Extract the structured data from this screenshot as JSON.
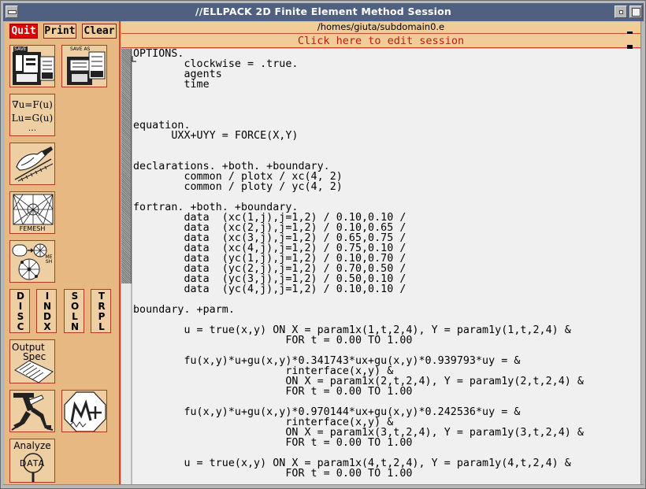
{
  "window": {
    "title": "//ELLPACK 2D Finite Element Method Session"
  },
  "toolbar": {
    "quit_label": "Quit",
    "print_label": "Print",
    "clear_label": "Clear"
  },
  "tools": {
    "save_label": "SAVE",
    "save_as_label": "SAVE AS",
    "pde_line1": "∇u=F(u)",
    "pde_line2": "Lu=G(u)",
    "pde_line3": "...",
    "femesh_label": "FEMESH",
    "mesh_label": "MESH",
    "discu": "DISCU",
    "indxu": "INDXU",
    "solnu": "SOLNU",
    "trplu": "TRPLU",
    "output_line1": "Output",
    "output_line2": "Spec",
    "analyze_line1": "Analyze",
    "analyze_line2": "DATA"
  },
  "session": {
    "path": "/homes/giuta/subdomain0.e",
    "edit_prompt": "Click here to edit session"
  },
  "code_lines": [
    "OPTIONS.",
    "        clockwise = .true.",
    "        agents",
    "        time",
    "",
    "",
    "",
    "equation.",
    "      UXX+UYY = FORCE(X,Y)",
    "",
    "",
    "declarations. +both. +boundary.",
    "        common / plotx / xc(4, 2)",
    "        common / ploty / yc(4, 2)",
    "",
    "fortran. +both. +boundary.",
    "        data  (xc(1,j),j=1,2) / 0.10,0.10 /",
    "        data  (xc(2,j),j=1,2) / 0.10,0.65 /",
    "        data  (xc(3,j),j=1,2) / 0.65,0.75 /",
    "        data  (xc(4,j),j=1,2) / 0.75,0.10 /",
    "        data  (yc(1,j),j=1,2) / 0.10,0.70 /",
    "        data  (yc(2,j),j=1,2) / 0.70,0.50 /",
    "        data  (yc(3,j),j=1,2) / 0.50,0.10 /",
    "        data  (yc(4,j),j=1,2) / 0.10,0.10 /",
    "",
    "boundary. +parm.",
    "",
    "        u = true(x,y) ON X = param1x(1,t,2,4), Y = param1y(1,t,2,4) &",
    "                        FOR t = 0.00 TO 1.00",
    "",
    "        fu(x,y)*u+gu(x,y)*0.341743*ux+gu(x,y)*0.939793*uy = &",
    "                        rinterface(x,y) &",
    "                        ON X = param1x(2,t,2,4), Y = param1y(2,t,2,4) &",
    "                        FOR t = 0.00 TO 1.00",
    "",
    "        fu(x,y)*u+gu(x,y)*0.970144*ux+gu(x,y)*0.242536*uy = &",
    "                        rinterface(x,y) &",
    "                        ON X = param1x(3,t,2,4), Y = param1y(3,t,2,4) &",
    "                        FOR t = 0.00 TO 1.00",
    "",
    "        u = true(x,y) ON X = param1x(4,t,2,4), Y = param1y(4,t,2,4) &",
    "                        FOR t = 0.00 TO 1.00"
  ],
  "colors": {
    "titlebar": "#506080",
    "panel": "#e8b882",
    "accent_red": "#c64b2c",
    "quit_red": "#e00000",
    "prompt_red": "#c01818"
  }
}
